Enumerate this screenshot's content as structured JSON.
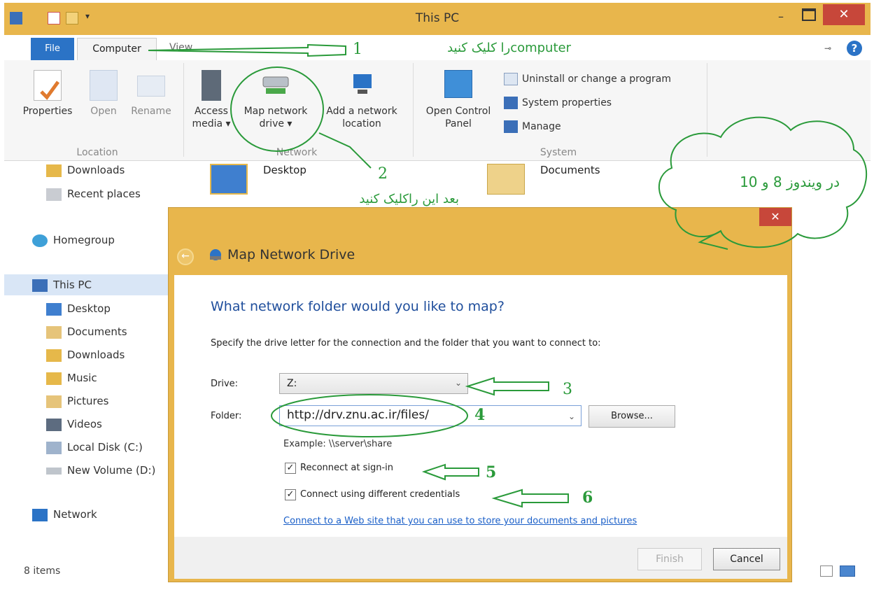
{
  "window": {
    "title": "This PC",
    "minimize": "–",
    "close": "✕"
  },
  "ribbon_tabs": {
    "file": "File",
    "computer": "Computer",
    "view": "View",
    "help": "?"
  },
  "ribbon": {
    "location": {
      "label": "Location",
      "properties": "Properties",
      "open": "Open",
      "rename": "Rename"
    },
    "network": {
      "label": "Network",
      "access_media_1": "Access",
      "access_media_2": "media ▾",
      "map_drive_1": "Map network",
      "map_drive_2": "drive ▾",
      "add_location_1": "Add a network",
      "add_location_2": "location"
    },
    "system": {
      "label": "System",
      "open_cp_1": "Open Control",
      "open_cp_2": "Panel",
      "uninstall": "Uninstall or change a program",
      "sys_props": "System properties",
      "manage": "Manage"
    }
  },
  "nav": {
    "downloads_top": "Downloads",
    "recent": "Recent places",
    "homegroup": "Homegroup",
    "this_pc": "This PC",
    "desktop": "Desktop",
    "documents": "Documents",
    "downloads": "Downloads",
    "music": "Music",
    "pictures": "Pictures",
    "videos": "Videos",
    "local_disk": "Local Disk (C:)",
    "new_volume": "New Volume (D:)",
    "network": "Network"
  },
  "content_items": {
    "desktop": "Desktop",
    "documents": "Documents"
  },
  "status": {
    "items": "8 items"
  },
  "dialog": {
    "title": "Map Network Drive",
    "close": "✕",
    "heading": "What network folder would you like to map?",
    "subtext": "Specify the drive letter for the connection and the folder that you want to connect to:",
    "drive_label": "Drive:",
    "drive_value": "Z:",
    "folder_label": "Folder:",
    "folder_value": "http://drv.znu.ac.ir/files/",
    "browse": "Browse...",
    "example": "Example: \\\\server\\share",
    "reconnect": "Reconnect at sign-in",
    "different_creds": "Connect using different credentials",
    "web_link": "Connect to a Web site that you can use to store your documents and pictures",
    "finish": "Finish",
    "cancel": "Cancel"
  },
  "annotations": {
    "step1": "1",
    "step1_text": "computerرا کلیک کنید",
    "step2": "2",
    "step2_text": "بعد این راکلیک کنید",
    "step3": "3",
    "step4": "4",
    "step5": "5",
    "step6": "6",
    "cloud_text": "در ویندوز 8 و 10"
  },
  "colors": {
    "frame": "#e8b64c",
    "file_tab": "#2b73c6",
    "close": "#c7473a",
    "annotation": "#2a9a3a",
    "heading": "#1f4e9c",
    "link": "#1a5fc8"
  }
}
